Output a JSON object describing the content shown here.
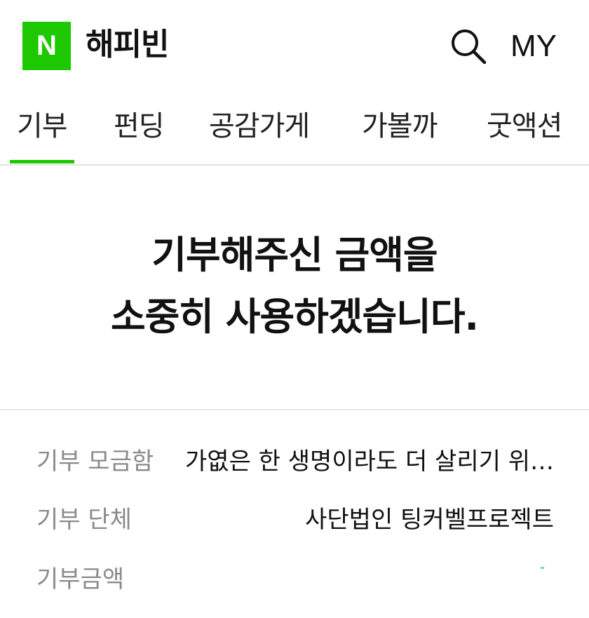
{
  "header": {
    "logo_letter": "N",
    "brand": "해피빈",
    "my_label": "MY",
    "icons": {
      "search": "search-icon"
    },
    "colors": {
      "accent": "#1ec800"
    }
  },
  "tabs": [
    {
      "label": "기부",
      "active": true
    },
    {
      "label": "펀딩",
      "active": false
    },
    {
      "label": "공감가게",
      "active": false
    },
    {
      "label": "가볼까",
      "active": false
    },
    {
      "label": "굿액션",
      "active": false
    }
  ],
  "thanks": {
    "line1": "기부해주신 금액을",
    "line2": "소중히 사용하겠습니다."
  },
  "details": {
    "fund_label": "기부 모금함",
    "fund_value": "가엾은 한 생명이라도 더 살리기 위…",
    "org_label": "기부 단체",
    "org_value": "사단법인 팅커벨프로젝트",
    "amount_label": "기부금액"
  }
}
